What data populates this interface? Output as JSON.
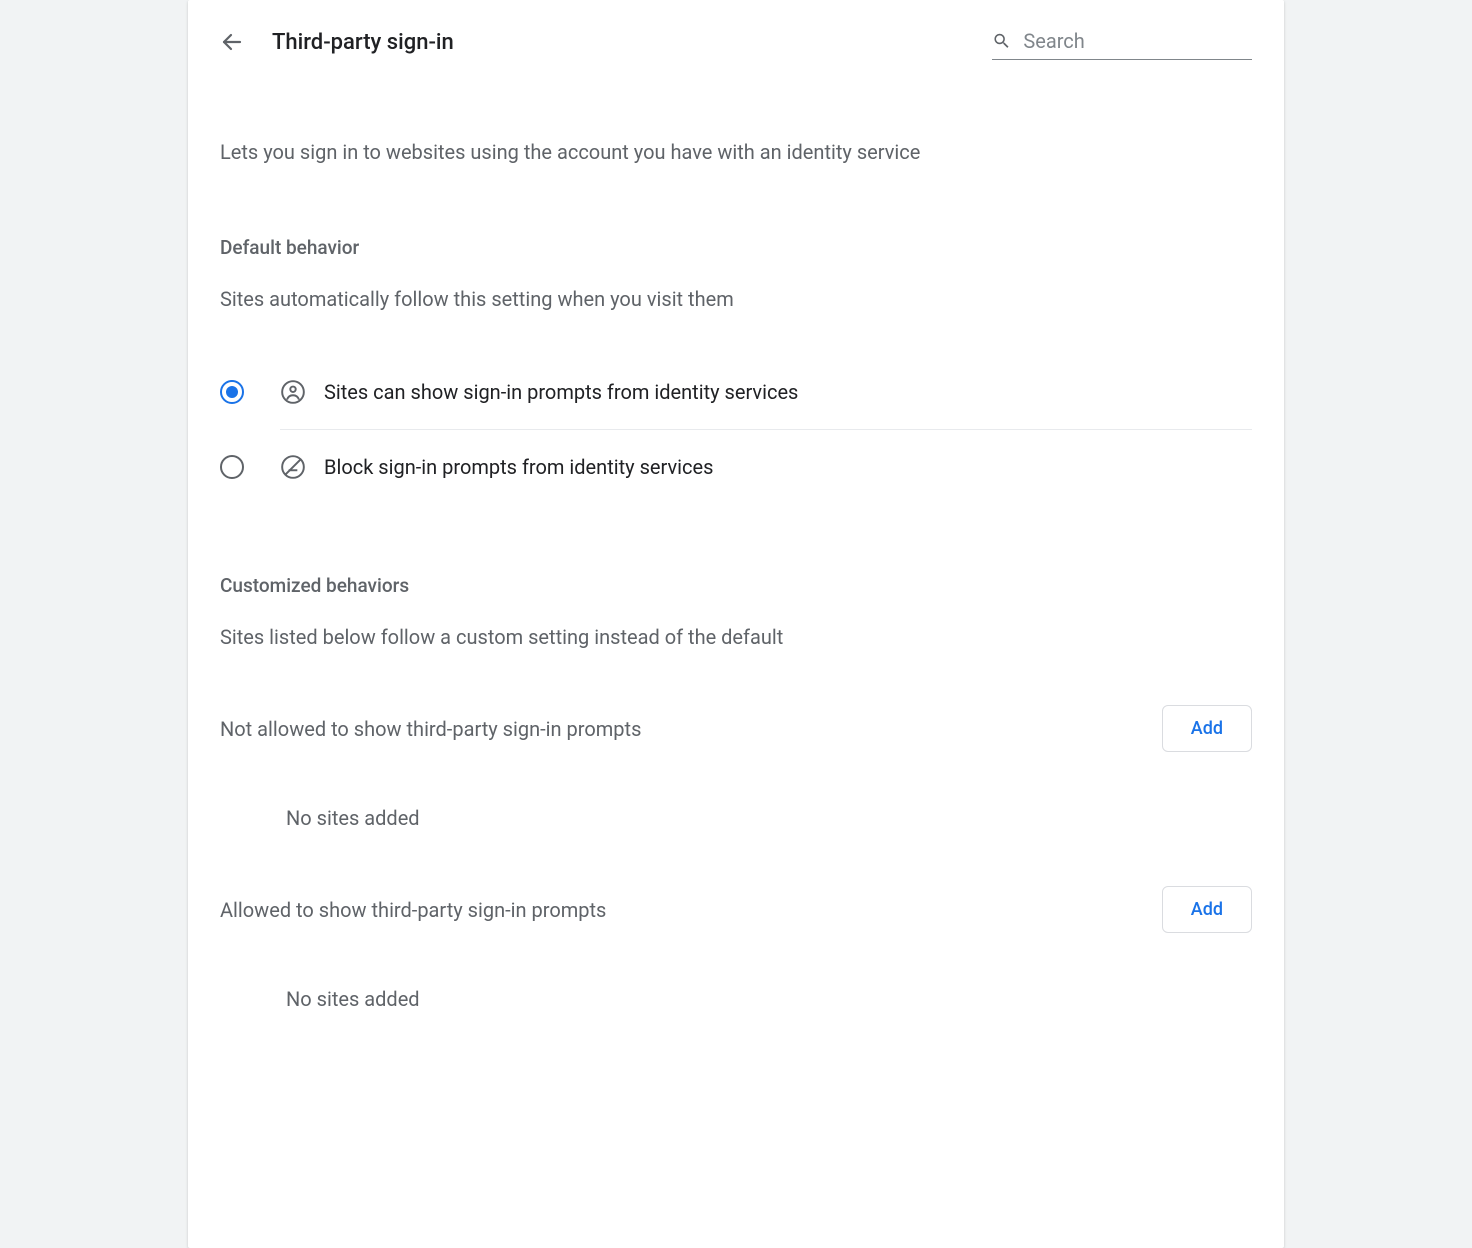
{
  "header": {
    "title": "Third-party sign-in",
    "search_placeholder": "Search"
  },
  "description": "Lets you sign in to websites using the account you have with an identity service",
  "default_behavior": {
    "title": "Default behavior",
    "description": "Sites automatically follow this setting when you visit them",
    "options": [
      {
        "label": "Sites can show sign-in prompts from identity services",
        "selected": true
      },
      {
        "label": "Block sign-in prompts from identity services",
        "selected": false
      }
    ]
  },
  "customized": {
    "title": "Customized behaviors",
    "description": "Sites listed below follow a custom setting instead of the default",
    "not_allowed": {
      "label": "Not allowed to show third-party sign-in prompts",
      "add_label": "Add",
      "empty": "No sites added"
    },
    "allowed": {
      "label": "Allowed to show third-party sign-in prompts",
      "add_label": "Add",
      "empty": "No sites added"
    }
  }
}
